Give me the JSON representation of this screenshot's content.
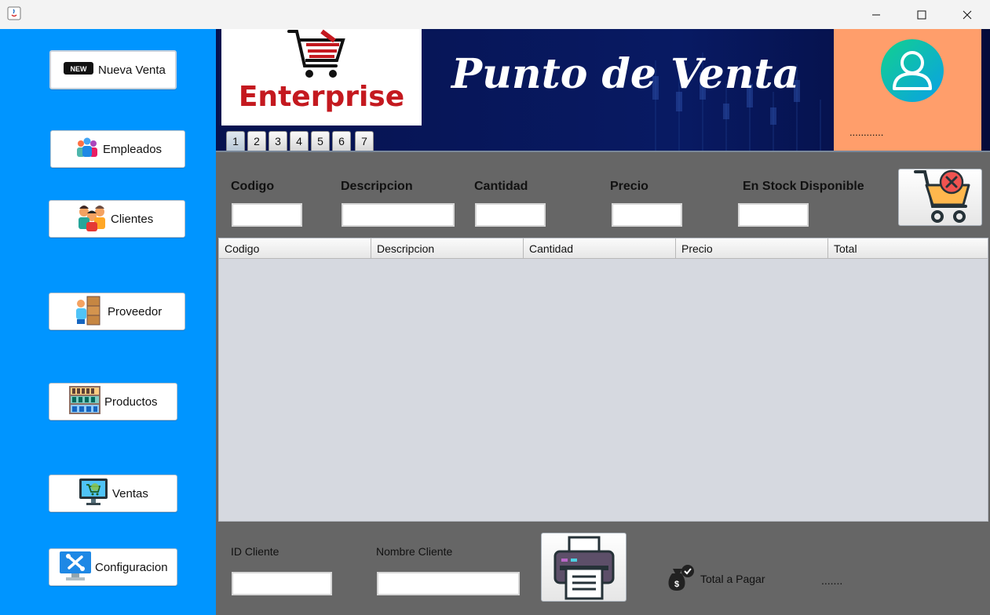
{
  "window": {
    "minimize_glyph": "—",
    "maximize_glyph": "☐",
    "close_glyph": "✕"
  },
  "sidebar": {
    "items": [
      {
        "label": "Nueva Venta",
        "icon": "new-tag-icon"
      },
      {
        "label": "Empleados",
        "icon": "people-group-icon"
      },
      {
        "label": "Clientes",
        "icon": "customers-icon"
      },
      {
        "label": "Proveedor",
        "icon": "supplier-boxes-icon"
      },
      {
        "label": "Productos",
        "icon": "shelves-icon"
      },
      {
        "label": "Ventas",
        "icon": "monitor-cart-icon"
      },
      {
        "label": "Configuracion",
        "icon": "settings-tools-icon"
      }
    ]
  },
  "header": {
    "logo_text": "Enterprise",
    "title": "Punto de Venta",
    "user_name": "............"
  },
  "tabs": [
    "1",
    "2",
    "3",
    "4",
    "5",
    "6",
    "7"
  ],
  "form": {
    "codigo_label": "Codigo",
    "descripcion_label": "Descripcion",
    "cantidad_label": "Cantidad",
    "precio_label": "Precio",
    "stock_label": "En Stock Disponible",
    "codigo_value": "",
    "descripcion_value": "",
    "cantidad_value": "",
    "precio_value": "",
    "stock_value": ""
  },
  "table": {
    "columns": [
      "Codigo",
      "Descripcion",
      "Cantidad",
      "Precio",
      "Total"
    ],
    "rows": []
  },
  "footer": {
    "id_cliente_label": "ID Cliente",
    "nombre_cliente_label": "Nombre Cliente",
    "id_cliente_value": "",
    "nombre_cliente_value": "",
    "total_label": "Total a Pagar",
    "total_value": "......."
  },
  "colors": {
    "sidebar": "#0095ff",
    "header": "#050f4d",
    "user_panel": "#ff9e6b",
    "content_bg": "#666666",
    "logo_red": "#c4191f"
  }
}
